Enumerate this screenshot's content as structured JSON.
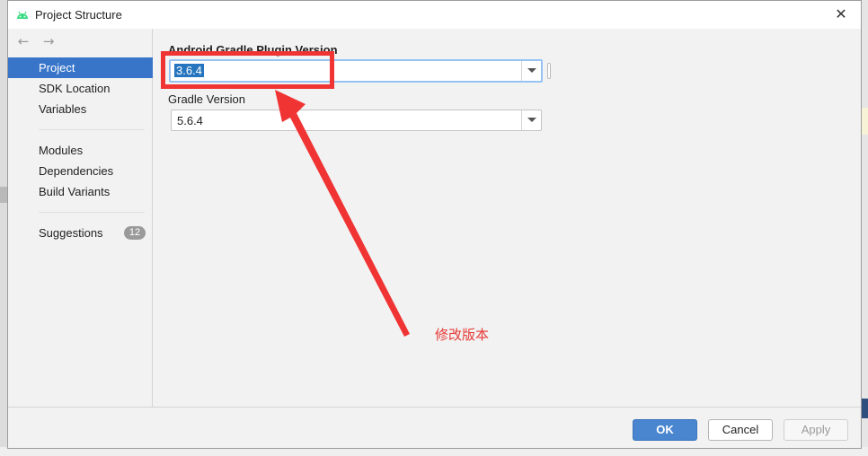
{
  "window": {
    "title": "Project Structure",
    "close_glyph": "✕",
    "app_icon": "android-icon"
  },
  "nav": {
    "back_glyph": "←",
    "forward_glyph": "→"
  },
  "sidebar": {
    "items": [
      {
        "label": "Project",
        "active": true
      },
      {
        "label": "SDK Location"
      },
      {
        "label": "Variables"
      },
      {
        "label": "Modules"
      },
      {
        "label": "Dependencies"
      },
      {
        "label": "Build Variants"
      },
      {
        "label": "Suggestions",
        "badge": "12"
      }
    ]
  },
  "content": {
    "plugin_version_label": "Android Gradle Plugin Version",
    "plugin_version_value": "3.6.4",
    "gradle_version_label": "Gradle Version",
    "gradle_version_value": "5.6.4"
  },
  "annotation": {
    "text": "修改版本",
    "color": "#f03333"
  },
  "footer": {
    "ok_label": "OK",
    "cancel_label": "Cancel",
    "apply_label": "Apply"
  },
  "colors": {
    "accent": "#3875c9",
    "primary_button": "#4a86d0"
  }
}
